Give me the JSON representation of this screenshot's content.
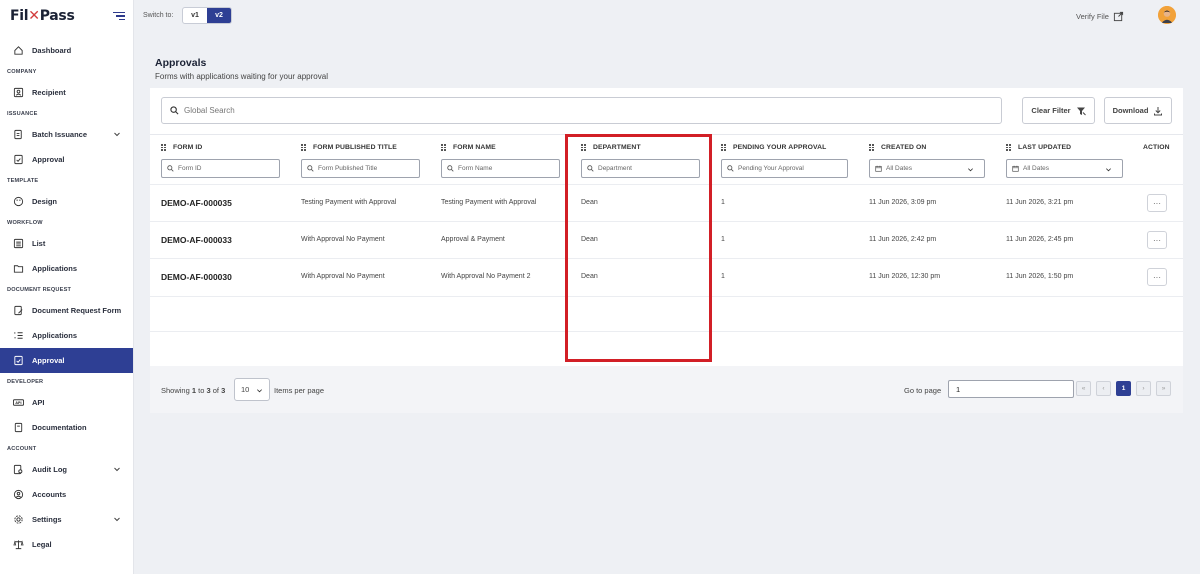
{
  "brand": {
    "logo_text_a": "Fil",
    "logo_text_b": "Pass",
    "accent": "#2e3f94",
    "highlight": "#d21f26"
  },
  "sidebar": {
    "dashboard": "Dashboard",
    "sec_company": "COMPANY",
    "recipient": "Recipient",
    "sec_issuance": "ISSUANCE",
    "batch_issuance": "Batch Issuance",
    "approval_issuance": "Approval",
    "sec_template": "TEMPLATE",
    "design": "Design",
    "sec_workflow": "WORKFLOW",
    "list": "List",
    "applications_wf": "Applications",
    "sec_docreq": "DOCUMENT REQUEST",
    "doc_request_form": "Document Request Form",
    "applications_dr": "Applications",
    "approval_dr": "Approval",
    "sec_developer": "DEVELOPER",
    "api": "API",
    "documentation": "Documentation",
    "sec_account": "ACCOUNT",
    "audit_log": "Audit Log",
    "accounts": "Accounts",
    "settings": "Settings",
    "legal": "Legal"
  },
  "topbar": {
    "switch_label": "Switch to:",
    "v1": "v1",
    "v2": "v2",
    "verify": "Verify File"
  },
  "page": {
    "title": "Approvals",
    "subtitle": "Forms with applications waiting for your approval"
  },
  "toolbar": {
    "search_placeholder": "Global Search",
    "clear_filter": "Clear Filter",
    "download": "Download"
  },
  "table": {
    "headers": {
      "form_id": "FORM ID",
      "published_title": "FORM PUBLISHED TITLE",
      "form_name": "FORM NAME",
      "department": "DEPARTMENT",
      "pending": "PENDING YOUR APPROVAL",
      "created": "CREATED ON",
      "updated": "LAST UPDATED",
      "action": "ACTION"
    },
    "filters": {
      "form_id": "Form ID",
      "published_title": "Form Published Title",
      "form_name": "Form Name",
      "department": "Department",
      "pending": "Pending Your Approval",
      "created": "All Dates",
      "updated": "All Dates"
    },
    "rows": [
      {
        "id": "DEMO-AF-000035",
        "title": "Testing Payment with Approval",
        "name": "Testing Payment with Approval",
        "dept": "Dean",
        "pending": "1",
        "created": "11 Jun 2026, 3:09 pm",
        "updated": "11 Jun 2026, 3:21 pm",
        "action": "···"
      },
      {
        "id": "DEMO-AF-000033",
        "title": "With Approval No Payment",
        "name": "Approval & Payment",
        "dept": "Dean",
        "pending": "1",
        "created": "11 Jun 2026, 2:42 pm",
        "updated": "11 Jun 2026, 2:45 pm",
        "action": "···"
      },
      {
        "id": "DEMO-AF-000030",
        "title": "With Approval No Payment",
        "name": "With Approval No Payment 2",
        "dept": "Dean",
        "pending": "1",
        "created": "11 Jun 2026, 12:30 pm",
        "updated": "11 Jun 2026, 1:50 pm",
        "action": "···"
      }
    ]
  },
  "footer": {
    "showing": "Showing",
    "from": "1",
    "to_word": "to",
    "to": "3",
    "of_word": "of",
    "total": "3",
    "per_page_value": "10",
    "per_page_label": "Items per page",
    "goto_label": "Go to page",
    "goto_value": "1",
    "first": "«",
    "prev": "‹",
    "current_page": "1",
    "next": "›",
    "last": "»"
  }
}
